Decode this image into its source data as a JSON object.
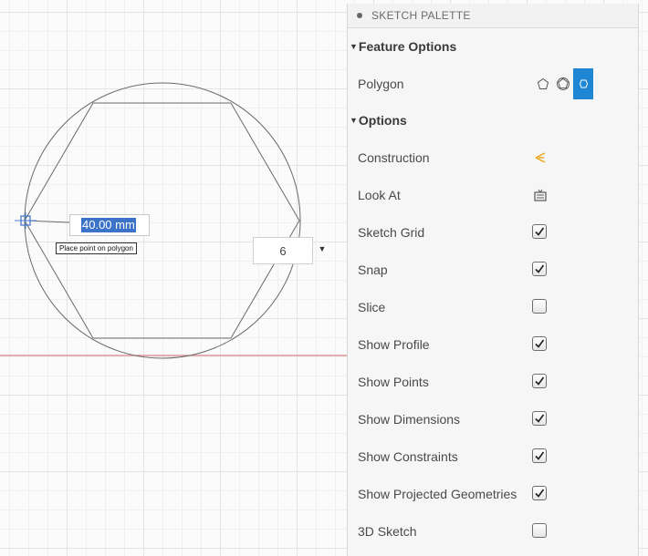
{
  "canvas": {
    "dimension_value": "40.00 mm",
    "tooltip": "Place point on polygon",
    "sides_value": "6",
    "sides_dropdown_icon": "triangle-down-icon"
  },
  "palette": {
    "title": "SKETCH PALETTE",
    "feature_options": {
      "title": "Feature Options",
      "polygon_label": "Polygon",
      "polygon_types": [
        {
          "icon": "circumscribed-polygon-icon",
          "active": false
        },
        {
          "icon": "inscribed-polygon-icon",
          "active": false
        },
        {
          "icon": "edge-polygon-icon",
          "active": true
        }
      ]
    },
    "options": {
      "title": "Options",
      "items": [
        {
          "label": "Construction",
          "control": "construction-icon"
        },
        {
          "label": "Look At",
          "control": "look-at-icon"
        },
        {
          "label": "Sketch Grid",
          "control": "checkbox",
          "checked": true
        },
        {
          "label": "Snap",
          "control": "checkbox",
          "checked": true
        },
        {
          "label": "Slice",
          "control": "checkbox",
          "checked": false
        },
        {
          "label": "Show Profile",
          "control": "checkbox",
          "checked": true
        },
        {
          "label": "Show Points",
          "control": "checkbox",
          "checked": true
        },
        {
          "label": "Show Dimensions",
          "control": "checkbox",
          "checked": true
        },
        {
          "label": "Show Constraints",
          "control": "checkbox",
          "checked": true
        },
        {
          "label": "Show Projected Geometries",
          "control": "checkbox",
          "checked": true
        },
        {
          "label": "3D Sketch",
          "control": "checkbox",
          "checked": false
        }
      ]
    }
  },
  "colors": {
    "accent": "#1f86d3",
    "selection": "#3b73c9",
    "construction": "#e8a317",
    "axis_line": "#d98080"
  }
}
